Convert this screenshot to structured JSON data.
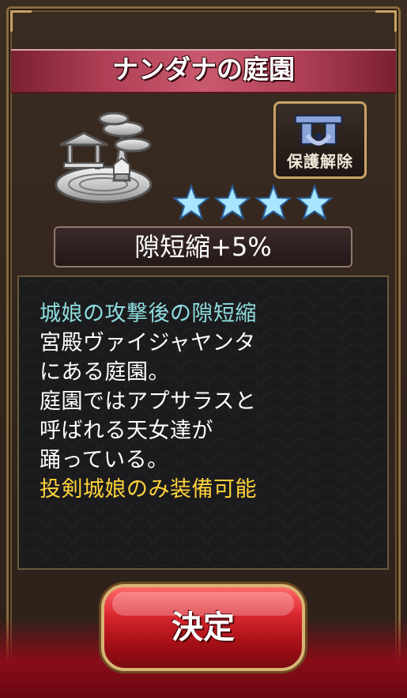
{
  "dialog": {
    "title": "ナンダナの庭園",
    "unprotect_label": "保護解除",
    "stars": 4,
    "effect": "隙短縮+5%",
    "description": {
      "effect_line": "城娘の攻撃後の隙短縮",
      "lines": [
        "宮殿ヴァイジャヤンタ",
        "にある庭園。",
        "庭園ではアプサラスと",
        "呼ばれる天女達が",
        "踊っている。"
      ],
      "note": "投剣城娘のみ装備可能"
    },
    "confirm_label": "決定"
  },
  "icons": {
    "garden": "garden-icon",
    "lock": "lock-icon",
    "star": "star-icon"
  },
  "colors": {
    "title_banner": "#b04055",
    "effect_line": "#8fdde0",
    "note_line": "#ffd23c",
    "button_red": "#d9262e",
    "gold": "#c9a464"
  }
}
